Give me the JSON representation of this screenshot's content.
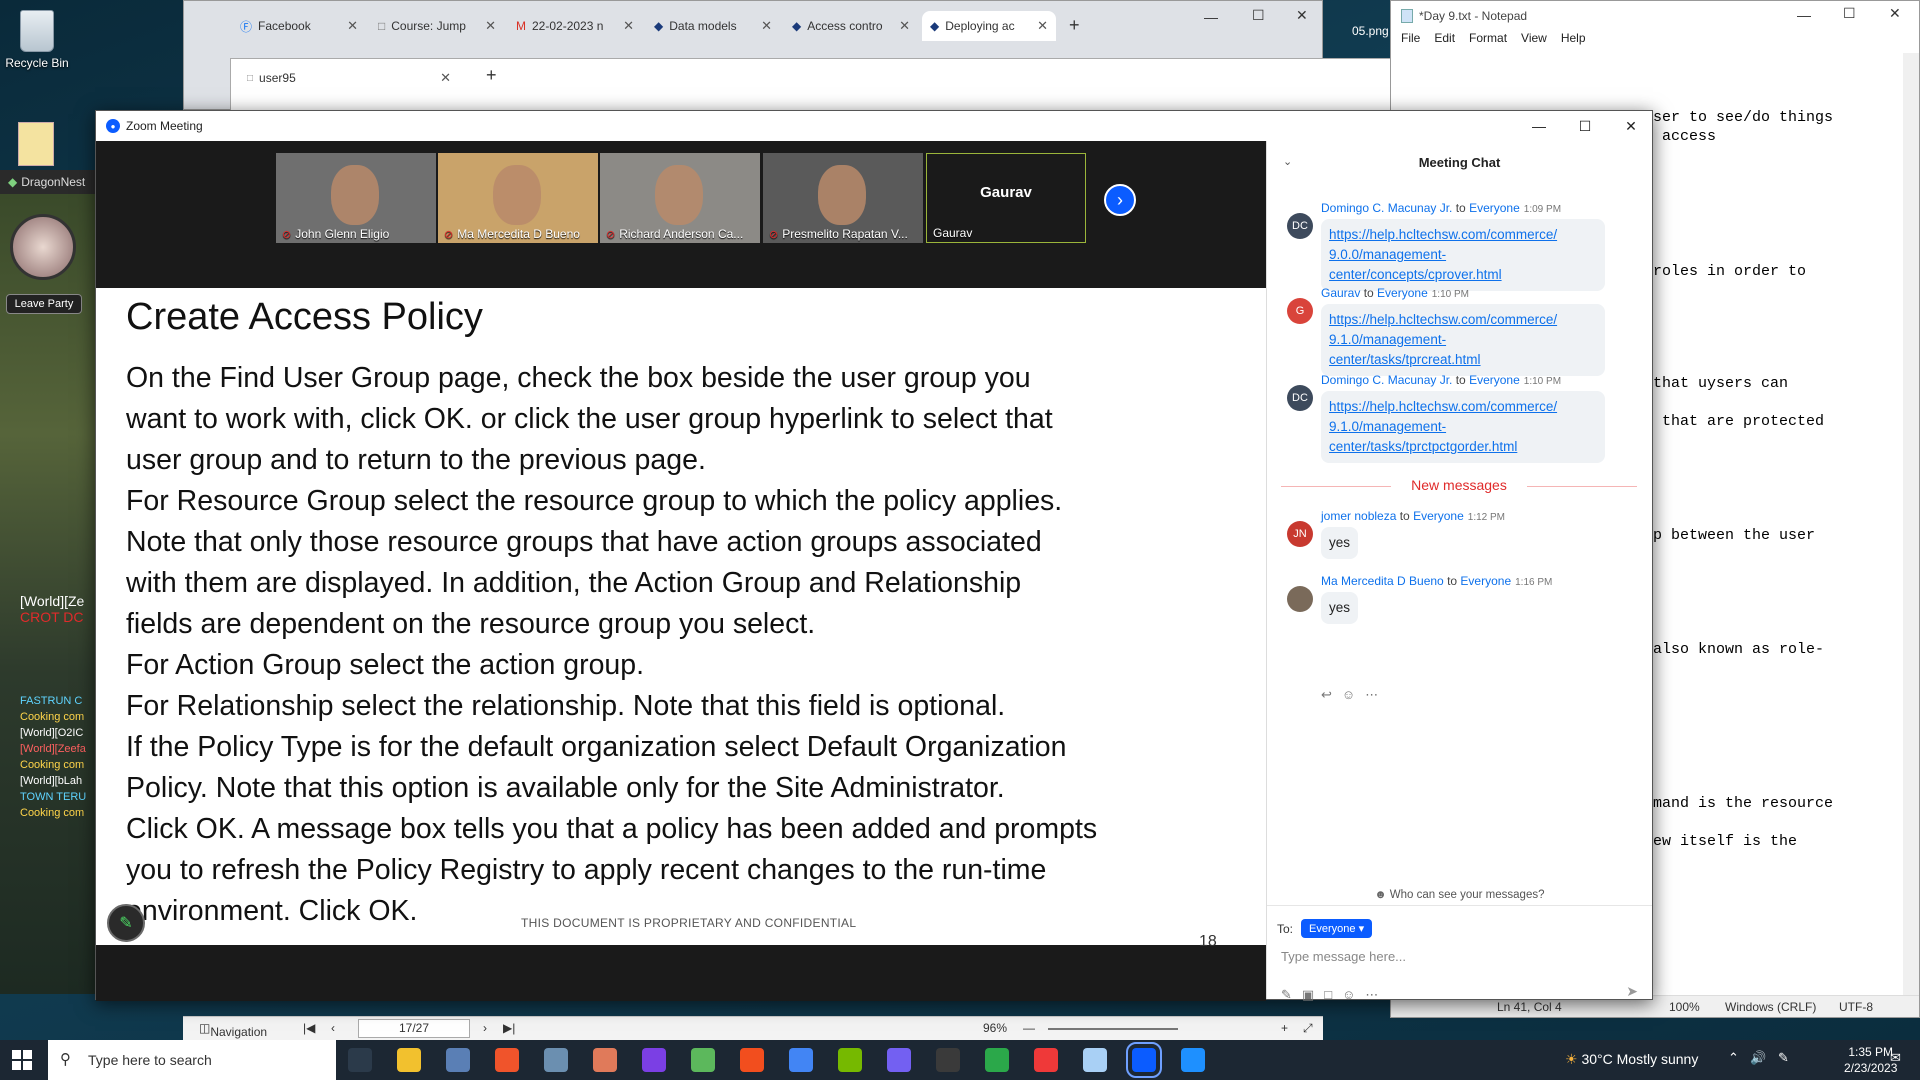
{
  "desktop": {
    "recycle_bin": "Recycle Bin",
    "dragonnest": "DragonNest",
    "leave_party": "Leave Party",
    "game_chat": [
      {
        "text": "[World][Ze",
        "color": "#ffffff"
      },
      {
        "text": "CROT DC",
        "color": "#e02b2b"
      },
      {
        "text": "FASTRUN C",
        "color": "#5fd4ff"
      },
      {
        "text": "Cooking com",
        "color": "#ffd54a"
      },
      {
        "text": "[World][O2IC",
        "color": "#ffffff"
      },
      {
        "text": "[World][Zeefa",
        "color": "#ff6060"
      },
      {
        "text": "Cooking com",
        "color": "#ffd54a"
      },
      {
        "text": "[World][bLah",
        "color": "#ffffff"
      },
      {
        "text": "TOWN TERU",
        "color": "#5fd4ff"
      },
      {
        "text": "Cooking com",
        "color": "#ffd54a"
      }
    ],
    "file_label": "05.png"
  },
  "browser": {
    "tabs": [
      {
        "label": "Facebook",
        "icon": "facebook-icon"
      },
      {
        "label": "Course: Jump",
        "icon": "page-icon"
      },
      {
        "label": "22-02-2023 n",
        "icon": "gmail-icon"
      },
      {
        "label": "Data models",
        "icon": "diamond-icon"
      },
      {
        "label": "Access contro",
        "icon": "diamond-icon"
      },
      {
        "label": "Deploying ac",
        "icon": "diamond-icon",
        "active": true
      }
    ],
    "second_window_tab": "user95"
  },
  "notepad": {
    "title": "*Day 9.txt - Notepad",
    "menu": [
      "File",
      "Edit",
      "Format",
      "View",
      "Help"
    ],
    "lines": [
      "ser to see/do things",
      " access",
      "roles in order to",
      "that uysers can",
      " that are protected",
      "p between the user",
      "also known as role-",
      "mand is the resource",
      "ew itself is the"
    ],
    "status": {
      "position": "Ln 41, Col 4",
      "zoom": "100%",
      "line_ending": "Windows (CRLF)",
      "encoding": "UTF-8"
    }
  },
  "zoom": {
    "title": "Zoom Meeting",
    "participants": [
      {
        "name": "John Glenn Eligio",
        "muted": true
      },
      {
        "name": "Ma Mercedita D Bueno",
        "muted": true
      },
      {
        "name": "Richard Anderson Ca...",
        "muted": true
      },
      {
        "name": "Presmelito Rapatan V...",
        "muted": true
      },
      {
        "name": "Gaurav",
        "muted": false,
        "no_video": true
      }
    ],
    "slide": {
      "title": "Create Access Policy",
      "lines": [
        "On the Find User Group page, check the box beside the user group you",
        "want to work with, click OK. or click the user group hyperlink to select that",
        "user group and to return to the previous page.",
        "For Resource Group select the resource group to which the policy applies.",
        "Note that only those resource groups that have action groups associated",
        "with them are displayed. In addition, the Action Group and Relationship",
        "fields are dependent on the resource group you select.",
        "For Action Group select the action group.",
        "For Relationship select the relationship. Note that this field is optional.",
        "If the Policy Type is for the default organization select Default Organization",
        "Policy. Note that this option is available only for the Site Administrator.",
        "Click OK. A message box tells you that a policy has been added and prompts",
        "you to refresh the Policy Registry to apply recent changes to the run-time",
        "environment. Click OK."
      ],
      "footer": "THIS DOCUMENT IS PROPRIETARY AND CONFIDENTIAL"
    },
    "chat": {
      "header": "Meeting Chat",
      "messages": [
        {
          "initials": "DC",
          "avatar_color": "#3d4a5c",
          "sender": "Domingo C. Macunay Jr.",
          "to": "to",
          "recipient": "Everyone",
          "time": "1:09 PM",
          "link": "https://help.hcltechsw.com/commerce/9.0.0/management-center/concepts/cprover.html",
          "link_lines": [
            "https://help.hcltechsw.com/commerce/",
            "9.0.0/management-",
            "center/concepts/cprover.html"
          ]
        },
        {
          "initials": "G",
          "avatar_color": "#d9443b",
          "sender": "Gaurav",
          "to": "to",
          "recipient": "Everyone",
          "time": "1:10 PM",
          "link": "https://help.hcltechsw.com/commerce/9.1.0/management-center/tasks/tprcreat.html",
          "link_lines": [
            "https://help.hcltechsw.com/commerce/",
            "9.1.0/management-",
            "center/tasks/tprcreat.html"
          ]
        },
        {
          "initials": "DC",
          "avatar_color": "#3d4a5c",
          "sender": "Domingo C. Macunay Jr.",
          "to": "to",
          "recipient": "Everyone",
          "time": "1:10 PM",
          "link": "https://help.hcltechsw.com/commerce/9.1.0/management-center/tasks/tprctpctgorder.html",
          "link_lines": [
            "https://help.hcltechsw.com/commerce/",
            "9.1.0/management-",
            "center/tasks/tprctpctgorder.html"
          ]
        }
      ],
      "new_messages": "New messages",
      "new": [
        {
          "initials": "JN",
          "avatar_color": "#c8392f",
          "sender": "jomer nobleza",
          "to": "to",
          "recipient": "Everyone",
          "time": "1:12 PM",
          "text": "yes"
        },
        {
          "initials": "",
          "avatar_color": "#7a6a5a",
          "sender": "Ma Mercedita D Bueno",
          "to": "to",
          "recipient": "Everyone",
          "time": "1:16 PM",
          "text": "yes"
        }
      ],
      "who_can_see": "Who can see your messages?",
      "to_label": "To:",
      "to_value": "Everyone",
      "input_placeholder": "Type message here..."
    }
  },
  "pdf_viewer": {
    "navigation_label": "Navigation",
    "page": "17/27",
    "zoom": "96%",
    "page_number_behind": "18"
  },
  "taskbar": {
    "search_placeholder": "Type here to search",
    "weather": "30°C  Mostly sunny",
    "time": "1:35 PM",
    "date": "2/23/2023",
    "apps": [
      {
        "icon": "task-view-icon",
        "color": "#2b3a4a"
      },
      {
        "icon": "file-explorer-icon",
        "color": "#f2c12e"
      },
      {
        "icon": "app-icon",
        "color": "#5a7fb5"
      },
      {
        "icon": "brave-icon",
        "color": "#f0542b"
      },
      {
        "icon": "picture-icon",
        "color": "#6b8fb0"
      },
      {
        "icon": "app-icon",
        "color": "#e07a5a"
      },
      {
        "icon": "intellij-icon",
        "color": "#7b3fe4"
      },
      {
        "icon": "notepad-icon",
        "color": "#5cb85c"
      },
      {
        "icon": "figma-icon",
        "color": "#f24e1e"
      },
      {
        "icon": "chrome-icon",
        "color": "#4285f4"
      },
      {
        "icon": "nvidia-icon",
        "color": "#76b900"
      },
      {
        "icon": "viber-icon",
        "color": "#7360f2"
      },
      {
        "icon": "obs-icon",
        "color": "#3a3a3a"
      },
      {
        "icon": "edge-icon",
        "color": "#2ba84a"
      },
      {
        "icon": "vivaldi-icon",
        "color": "#ef3939"
      },
      {
        "icon": "app-icon",
        "color": "#a9d0f5"
      },
      {
        "icon": "zoom-icon",
        "color": "#0b5cff"
      },
      {
        "icon": "photos-icon",
        "color": "#1e90ff"
      }
    ]
  }
}
